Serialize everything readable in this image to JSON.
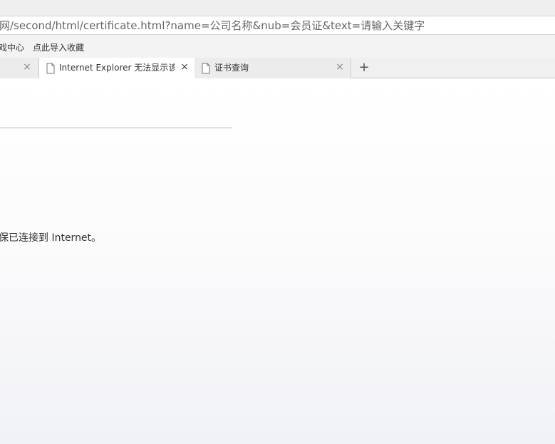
{
  "address_bar": {
    "url": "网/second/html/certificate.html?name=公司名称&nub=会员证&text=请输入关键字"
  },
  "bookmarks": [
    {
      "label": "戏中心"
    },
    {
      "label": "点此导入收藏"
    }
  ],
  "tabs": [
    {
      "title": "",
      "active": false,
      "close": "×"
    },
    {
      "title": "Internet Explorer 无法显示该",
      "active": true,
      "close": "×"
    },
    {
      "title": "证书查询",
      "active": false,
      "close": "×"
    }
  ],
  "new_tab_label": "+",
  "content": {
    "message": "保已连接到 Internet。"
  }
}
